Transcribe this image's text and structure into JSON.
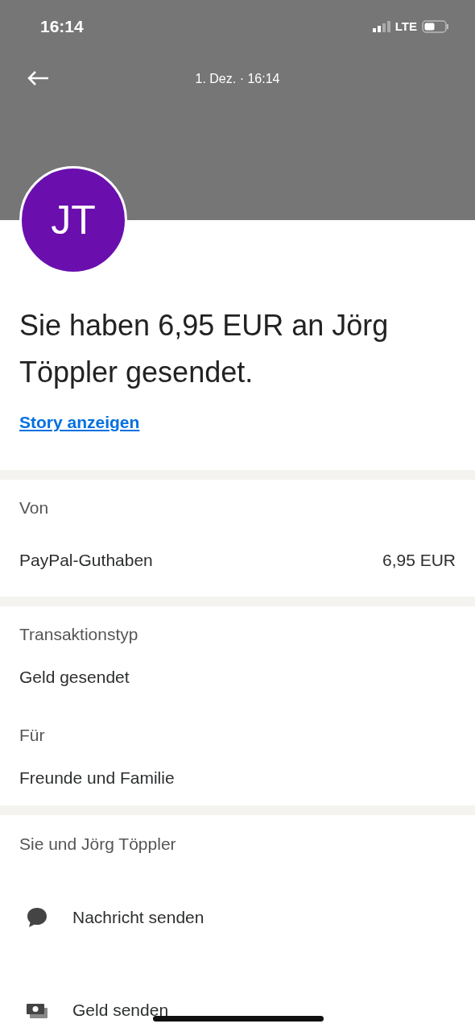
{
  "status_bar": {
    "time": "16:14",
    "network": "LTE"
  },
  "header": {
    "date": "1. Dez. · 16:14"
  },
  "avatar": {
    "initials": "JT",
    "color": "#6a0fae"
  },
  "headline": "Sie haben 6,95 EUR an Jörg Töppler gesendet.",
  "story_link": "Story anzeigen",
  "sections": [
    {
      "kind": "source",
      "label": "Von",
      "rows": [
        {
          "name": "PayPal-Guthaben",
          "amount": "6,95 EUR"
        }
      ]
    },
    {
      "kind": "details",
      "fields": [
        {
          "label": "Transaktionstyp",
          "value": "Geld gesendet"
        },
        {
          "label": "Für",
          "value": "Freunde und Familie"
        }
      ]
    },
    {
      "kind": "actions",
      "title": "Sie und Jörg Töppler",
      "actions": [
        {
          "kind": "message",
          "label": "Nachricht senden"
        },
        {
          "kind": "money",
          "label": "Geld senden"
        }
      ]
    }
  ]
}
